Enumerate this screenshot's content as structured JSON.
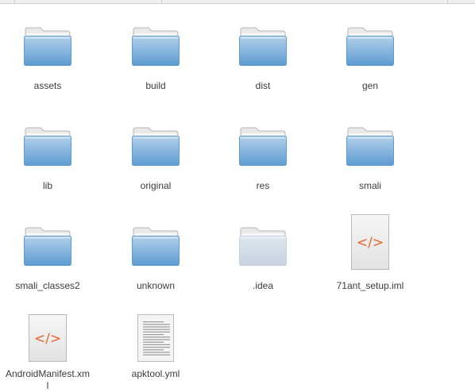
{
  "files": [
    {
      "name": "assets",
      "type": "folder"
    },
    {
      "name": "build",
      "type": "folder"
    },
    {
      "name": "dist",
      "type": "folder"
    },
    {
      "name": "gen",
      "type": "folder"
    },
    {
      "name": "lib",
      "type": "folder"
    },
    {
      "name": "original",
      "type": "folder"
    },
    {
      "name": "res",
      "type": "folder"
    },
    {
      "name": "smali",
      "type": "folder"
    },
    {
      "name": "smali_classes2",
      "type": "folder"
    },
    {
      "name": "unknown",
      "type": "folder"
    },
    {
      "name": ".idea",
      "type": "hidden-folder"
    },
    {
      "name": "71ant_setup.iml",
      "type": "code-file"
    },
    {
      "name": "AndroidManifest.xml",
      "type": "code-file"
    },
    {
      "name": "apktool.yml",
      "type": "text-file"
    }
  ],
  "icons": {
    "folder": "folder-icon",
    "hidden_folder": "folder-icon",
    "code_file": "code-file-icon",
    "text_file": "text-file-icon",
    "code_glyph": "</>"
  },
  "colors": {
    "folder_top": "#b2d0ea",
    "folder_bottom": "#5d9bd1",
    "hidden_folder": "#c7d3df",
    "code_glyph": "#e8632a",
    "label_text": "#3c3c3c"
  }
}
